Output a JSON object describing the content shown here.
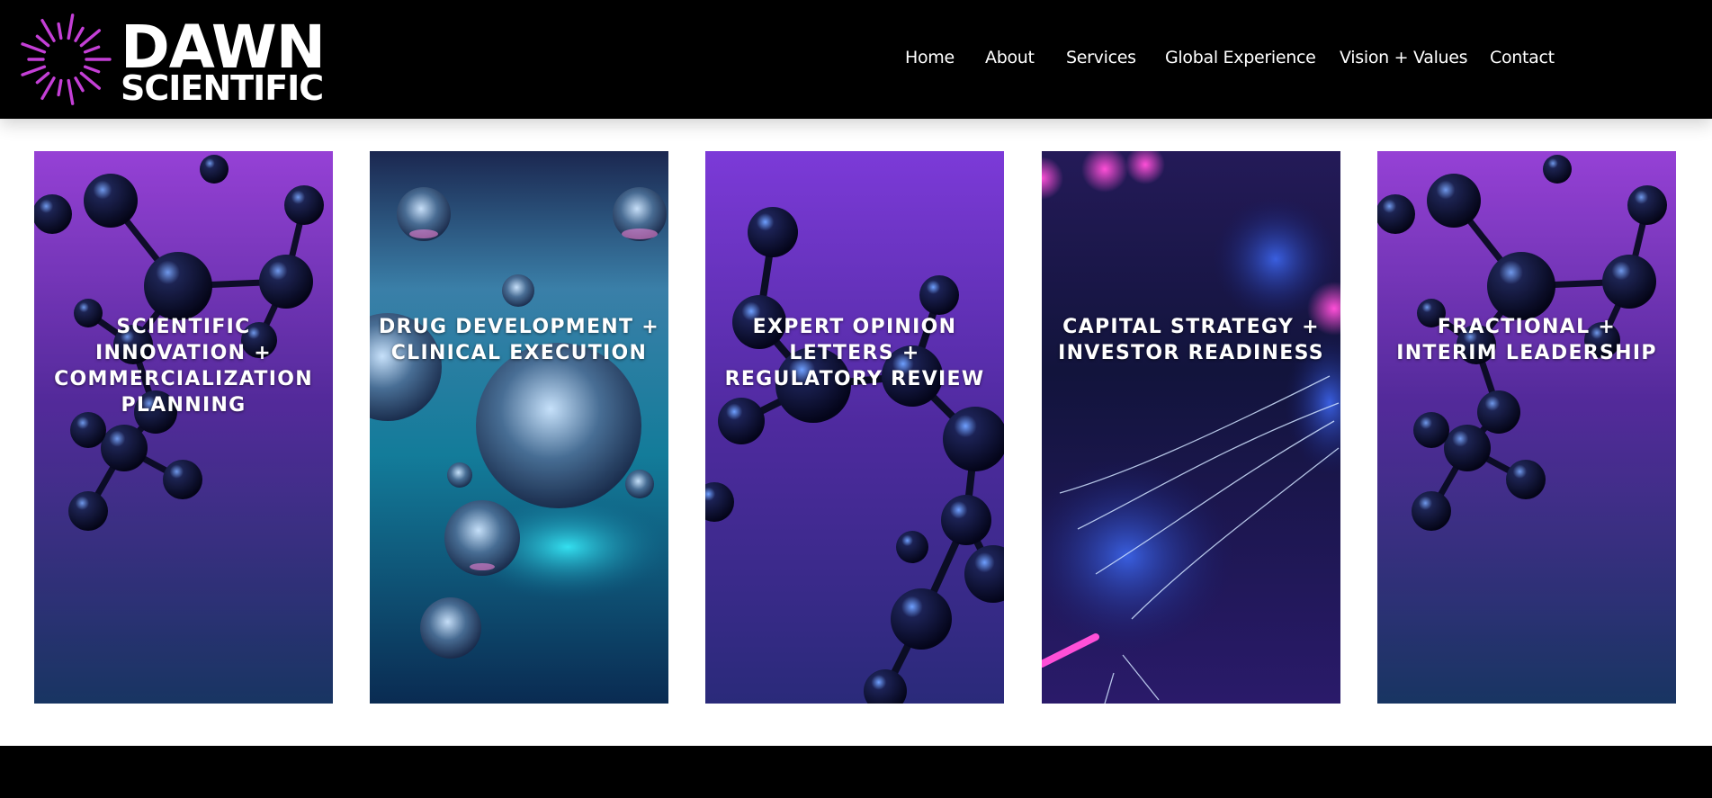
{
  "brand": {
    "line1": "DAWN",
    "line2": "SCIENTIFIC",
    "icon": "sunburst-logo-icon",
    "accent": "#c43fd6"
  },
  "nav": {
    "items": [
      {
        "label": "Home"
      },
      {
        "label": "About"
      },
      {
        "label": "Services"
      },
      {
        "label": "Global Experience"
      },
      {
        "label": "Vision + Values"
      },
      {
        "label": "Contact"
      }
    ]
  },
  "services": [
    {
      "title": "SCIENTIFIC INNOVATION + COMMERCIALIZATION PLANNING",
      "image": "purple-molecule-image"
    },
    {
      "title": "DRUG DEVELOPMENT + CLINICAL EXECUTION",
      "image": "teal-spheres-image"
    },
    {
      "title": "EXPERT OPINION LETTERS + REGULATORY REVIEW",
      "image": "violet-molecule-image"
    },
    {
      "title": "CAPITAL STRATEGY + INVESTOR READINESS",
      "image": "neural-network-image"
    },
    {
      "title": "FRACTIONAL + INTERIM LEADERSHIP",
      "image": "purple-molecule-image"
    }
  ],
  "colors": {
    "header_bg": "#000000",
    "page_bg": "#ffffff",
    "purple_top": "#9d3fe0",
    "navy_bottom": "#1a3a6a",
    "teal": "#1fb6d0"
  }
}
